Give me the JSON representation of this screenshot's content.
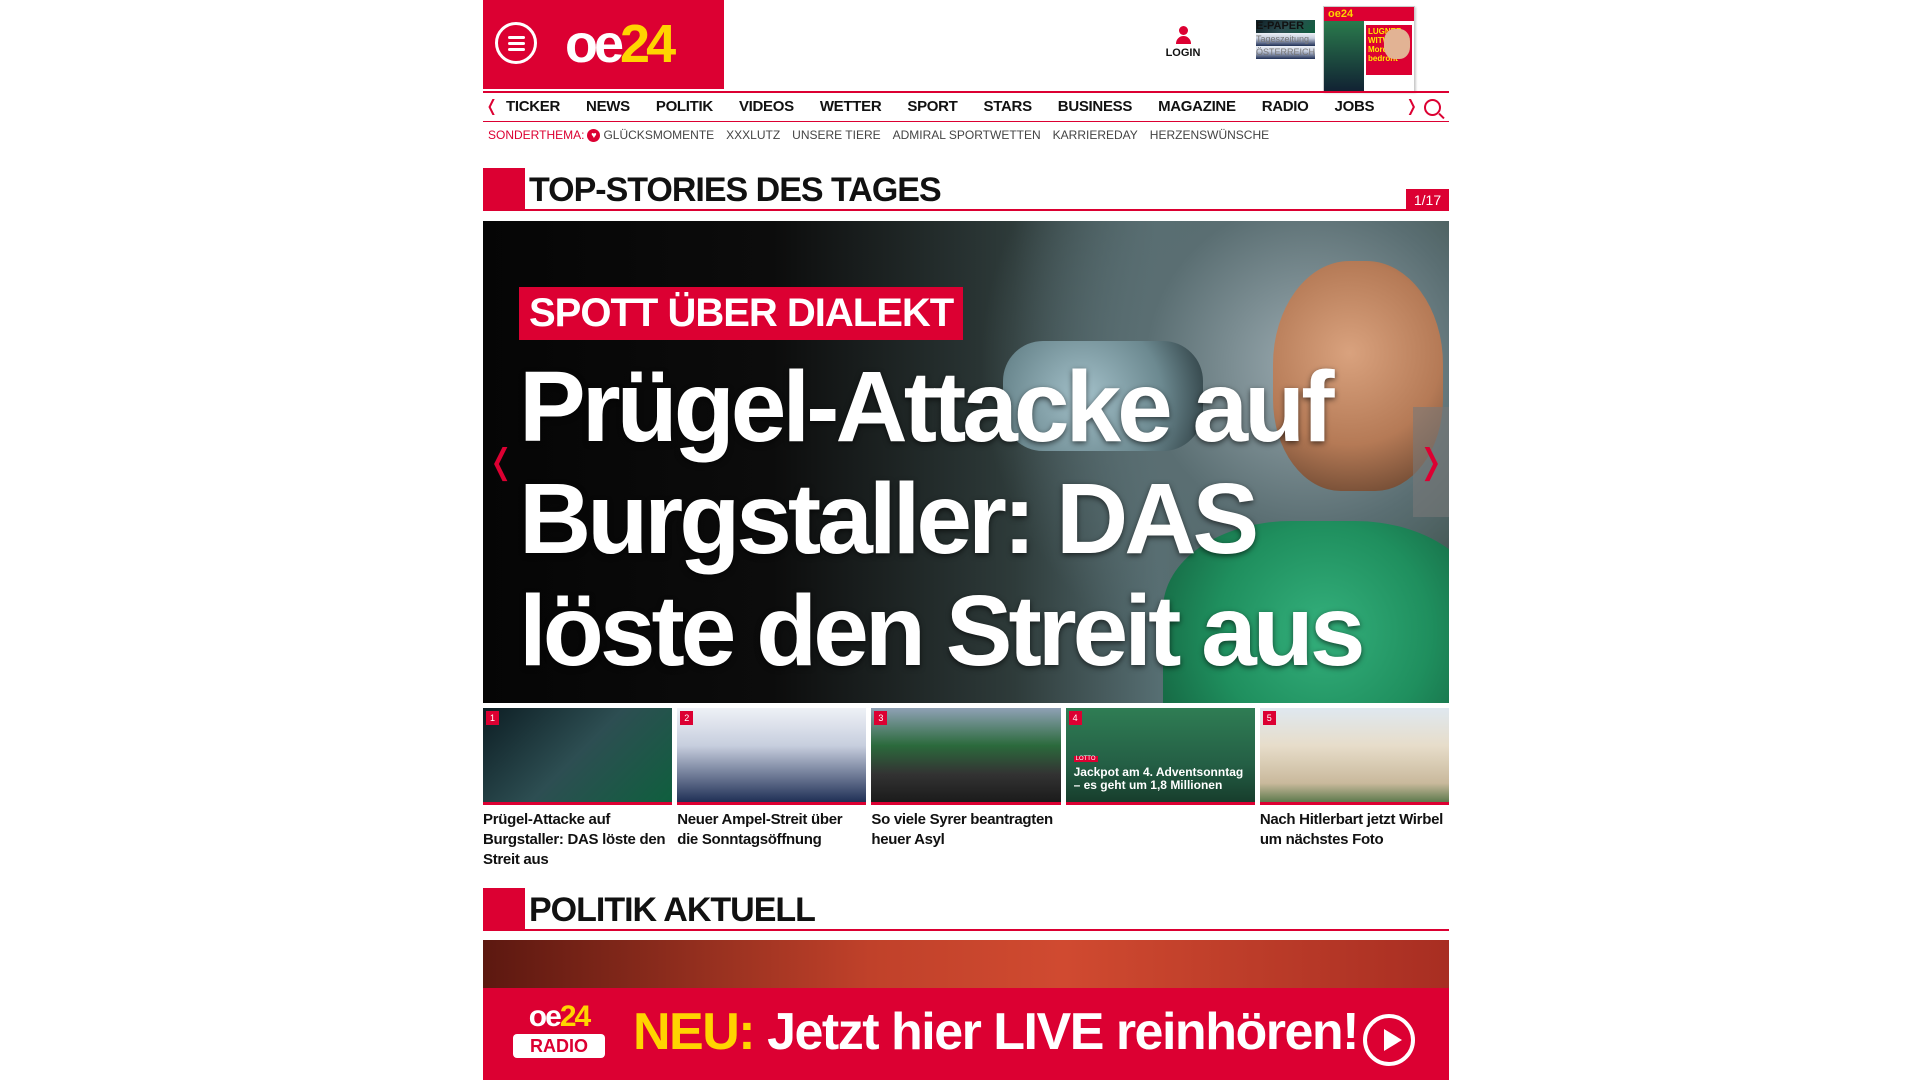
{
  "header": {
    "logo_text_a": "oe",
    "logo_text_b": "24",
    "login_label": "LOGIN",
    "epaper_title": "E-PAPER",
    "epaper_sub1": "Tageszeitung",
    "epaper_sub2": "ÖSTERREICH",
    "cover_band": "oe24",
    "cover_text": "LUGNER-WITWE mit Mord bedroht"
  },
  "nav": {
    "items": [
      "TICKER",
      "NEWS",
      "POLITIK",
      "VIDEOS",
      "WETTER",
      "SPORT",
      "STARS",
      "BUSINESS",
      "MAGAZINE",
      "RADIO",
      "JOBS"
    ]
  },
  "subnav": {
    "lead": "SONDERTHEMA:",
    "items": [
      "GLÜCKSMOMENTE",
      "XXXLUTZ",
      "UNSERE TIERE",
      "ADMIRAL SPORTWETTEN",
      "KARRIEREDAY",
      "HERZENSWÜNSCHE"
    ]
  },
  "top_stories": {
    "title": "TOP-STORIES DES TAGES",
    "pager": "1/17",
    "hero": {
      "kicker": "SPOTT ÜBER DIALEKT",
      "headline": "Prügel-Attacke auf Burgstaller: DAS löste den Streit aus"
    },
    "thumbs": [
      {
        "num": "1",
        "caption": "Prügel-Attacke auf Burgstaller: DAS löste den Streit aus"
      },
      {
        "num": "2",
        "caption": "Neuer Ampel-Streit über die Sonntagsöffnung"
      },
      {
        "num": "3",
        "caption": "So viele Syrer beantragten heuer Asyl"
      },
      {
        "num": "4",
        "caption": "",
        "overlay": "Jackpot am 4. Adventsonntag – es geht um 1,8 Millionen",
        "badge": "LOTTO"
      },
      {
        "num": "5",
        "caption": "Nach Hitlerbart jetzt Wirbel um nächstes Foto"
      }
    ]
  },
  "politik": {
    "title": "POLITIK AKTUELL"
  },
  "radio_banner": {
    "logo_a": "oe",
    "logo_b": "24",
    "logo_radio": "RADIO",
    "neu": "NEU:",
    "text": "Jetzt hier LIVE reinhören!"
  },
  "colors": {
    "brand_red": "#dc0032",
    "brand_yellow": "#ffd400"
  }
}
